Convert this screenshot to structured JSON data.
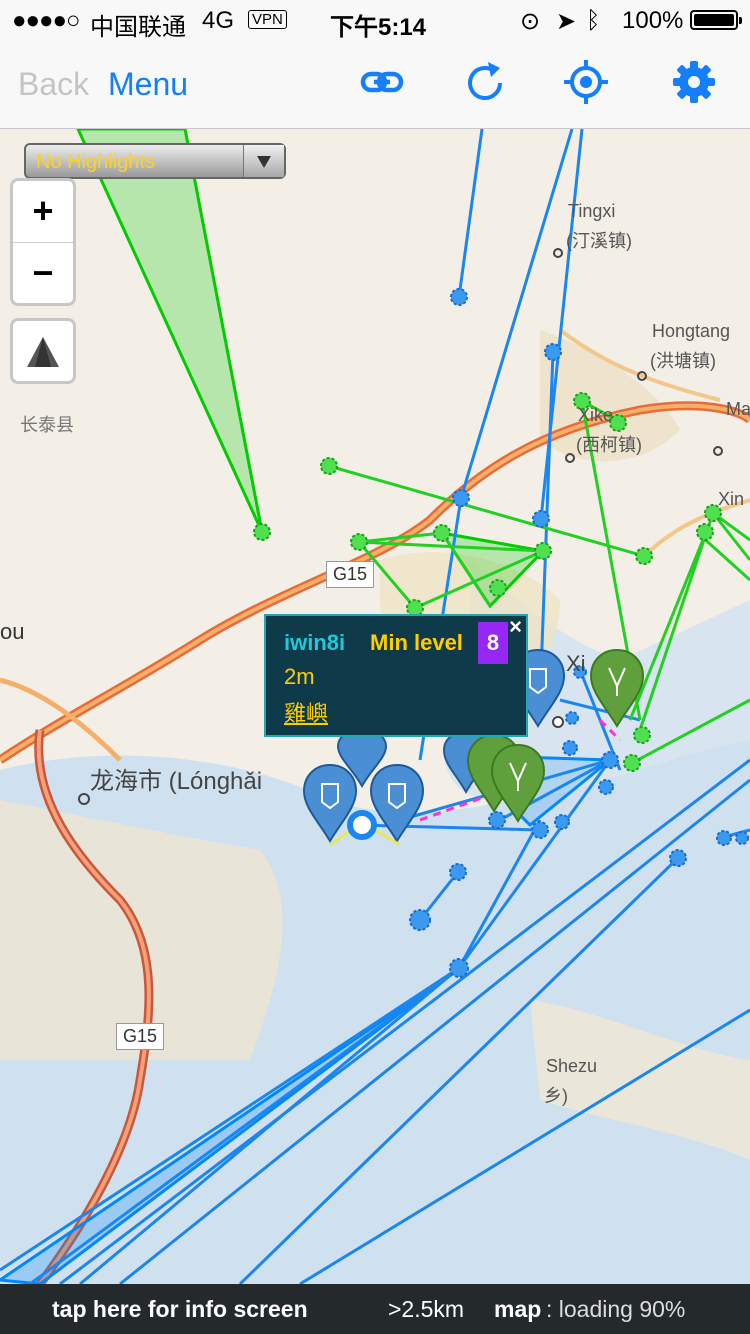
{
  "status_bar": {
    "signal": "●●●●○",
    "carrier": "中国联通",
    "network": "4G",
    "vpn": "VPN",
    "time": "下午5:14",
    "battery": "100%"
  },
  "nav": {
    "back": "Back",
    "menu": "Menu",
    "icons": [
      "link-icon",
      "refresh-icon",
      "locate-icon",
      "gear-icon"
    ],
    "accent": "#147efb"
  },
  "map": {
    "highlight_select": "No Highlights",
    "zoom_in": "+",
    "zoom_out": "−",
    "labels": {
      "tingxi": "Tingxi",
      "tingxi_cn": "(汀溪镇)",
      "hongtang": "Hongtang",
      "hongtang_cn": "(洪塘镇)",
      "xike": "Xike",
      "xike_cn": "(西柯镇)",
      "changtai": "长泰县",
      "ma": "Ma",
      "xin": "Xin",
      "g15_a": "G15",
      "g15_b": "G15",
      "ou": "ou",
      "longhai": "龙海市 (Lónghǎi",
      "shezu": "Shezu",
      "shezu_cn": "乡)",
      "xiamen_partial": "Xi"
    },
    "colors": {
      "resistance": "#0088ff",
      "enlightened": "#00cc00",
      "enlightened_portal": "#5a9e3a",
      "resistance_portal": "#3a7fc4"
    }
  },
  "popup": {
    "name": "iwin8i",
    "min_level_label": "Min level",
    "level": "8",
    "close": "×",
    "distance": "2m",
    "place": "雞嶼"
  },
  "bottom_bar": {
    "info_link": "tap here for info screen",
    "distance": ">2.5km",
    "map_label": "map",
    "map_status": ": loading 90%"
  }
}
